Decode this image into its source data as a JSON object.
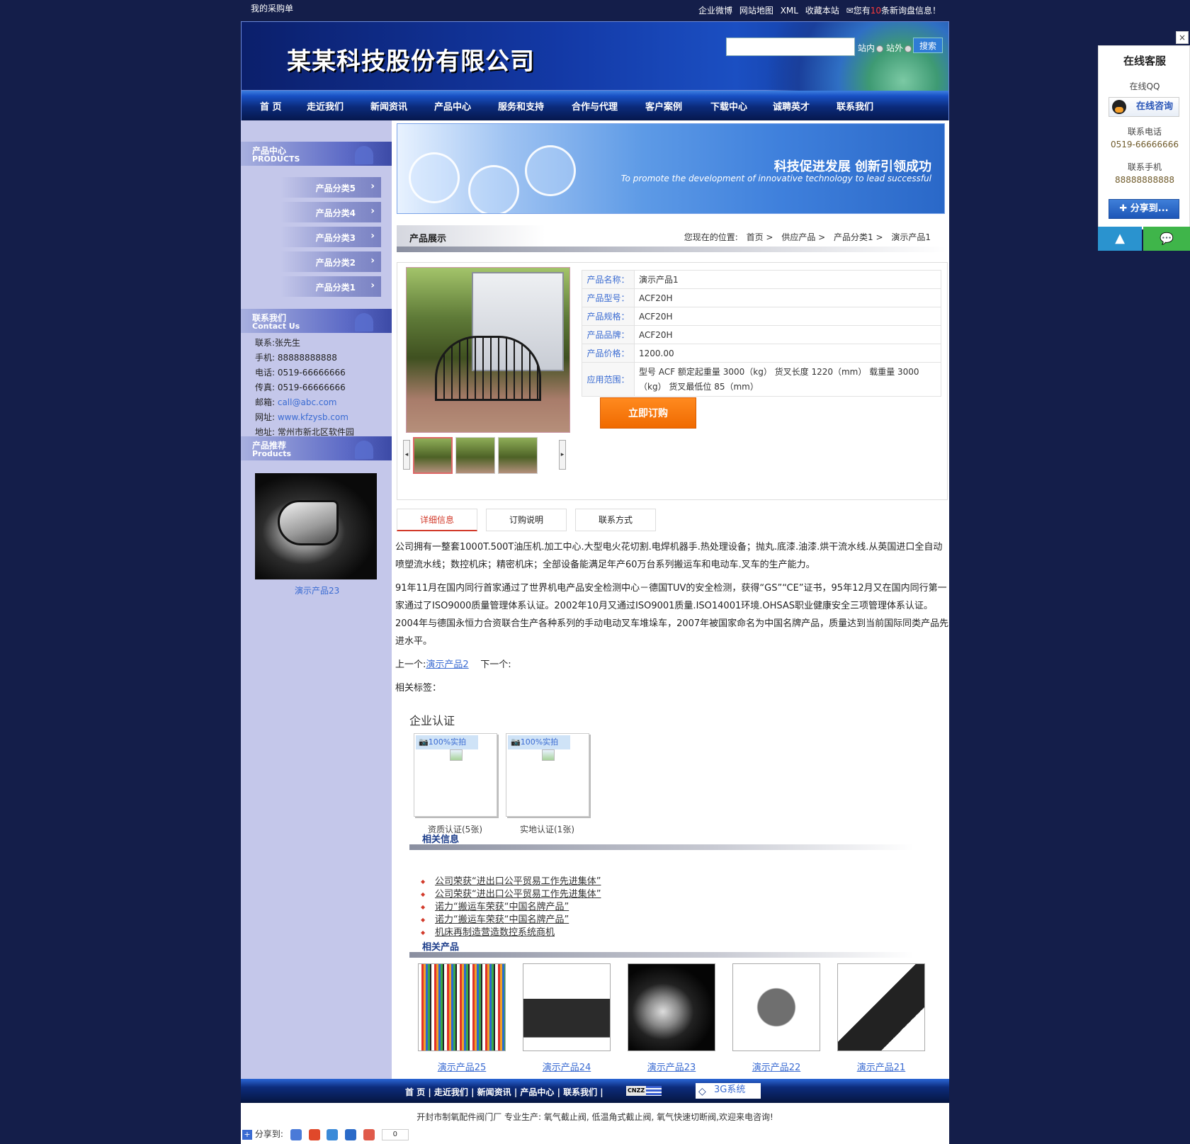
{
  "topbar": {
    "cart": "我的采购单",
    "links": [
      "企业微博",
      "网站地图",
      "XML",
      "收藏本站"
    ],
    "msg_prefix": "您有",
    "msg_count": "10",
    "msg_suffix": "条新询盘信息！"
  },
  "header": {
    "company": "某某科技股份有限公司",
    "search_placeholder": "",
    "scope_site": "站内",
    "scope_web": "站外",
    "search_label": "搜索"
  },
  "nav": [
    "首 页",
    "走近我们",
    "新闻资讯",
    "产品中心",
    "服务和支持",
    "合作与代理",
    "客户案例",
    "下载中心",
    "诚聘英才",
    "联系我们"
  ],
  "sidebar": {
    "products_title": "产品中心",
    "products_en": "PRODUCTS",
    "categories": [
      "产品分类5",
      "产品分类4",
      "产品分类3",
      "产品分类2",
      "产品分类1"
    ],
    "contact_title": "联系我们",
    "contact_en": "Contact Us",
    "contact_lines": [
      "联系:张先生",
      "手机: 88888888888",
      "电话: 0519-66666666",
      "传真: 0519-66666666"
    ],
    "email_label": "邮箱: ",
    "email": "call@abc.com",
    "website_label": "网址: ",
    "website": "www.kfzysb.com",
    "address": "地址: 常州市新北区软件园",
    "recommend_title": "产品推荐",
    "recommend_en": "Products",
    "recommend_item": "演示产品23"
  },
  "banner": {
    "title": "科技促进发展  创新引领成功",
    "subtitle": "To promote the development of innovative technology to lead successful"
  },
  "crumb": {
    "section": "产品展示",
    "prefix": "您现在的位置:",
    "items": [
      "首页 >",
      "供应产品 >",
      "产品分类1 >",
      "演示产品1"
    ]
  },
  "product": {
    "specs": [
      {
        "k": "产品名称：",
        "v": "演示产品1"
      },
      {
        "k": "产品型号：",
        "v": "ACF20H"
      },
      {
        "k": "产品规格：",
        "v": "ACF20H"
      },
      {
        "k": "产品品牌：",
        "v": "ACF20H"
      },
      {
        "k": "产品价格：",
        "v": "1200.00"
      },
      {
        "k": "应用范围：",
        "v": "型号 ACF 额定起重量 3000（kg） 货叉长度 1220（mm） 载重量 3000（kg） 货叉最低位 85（mm）"
      }
    ],
    "buy_label": "立即订购"
  },
  "tabs": [
    "详细信息",
    "订购说明",
    "联系方式"
  ],
  "description": {
    "p1": "公司拥有一整套1000T.500T油压机.加工中心.大型电火花切割.电焊机器手.热处理设备；抛丸.底漆.油漆.烘干流水线.从英国进口全自动喷塑流水线；数控机床；精密机床；全部设备能满足年产60万台系列搬运车和电动车.叉车的生产能力。",
    "p2": "91年11月在国内同行首家通过了世界机电产品安全检测中心－德国TUV的安全检测，获得“GS”“CE”证书，95年12月又在国内同行第一家通过了ISO9000质量管理体系认证。2002年10月又通过ISO9001质量.ISO14001环境.OHSAS职业健康安全三项管理体系认证。2004年与德国永恒力合资联合生产各种系列的手动电动叉车堆垛车，2007年被国家命名为中国名牌产品，质量达到当前国际同类产品先进水平。",
    "prev_label": "上一个:",
    "prev_link": "演示产品2",
    "next_label": "下一个:",
    "tags_label": "相关标签："
  },
  "certs": {
    "title": "企业认证",
    "badge": "100%实拍",
    "items": [
      "资质认证(5张)",
      "实地认证(1张)"
    ]
  },
  "related_info": {
    "title": "相关信息",
    "items": [
      "公司荣获“进出口公平贸易工作先进集体”",
      "公司荣获“进出口公平贸易工作先进集体”",
      "诺力“搬运车荣获“中国名牌产品”",
      "诺力“搬运车荣获“中国名牌产品”",
      "机床再制造营造数控系统商机"
    ]
  },
  "related_products": {
    "title": "相关产品",
    "items": [
      "演示产品25",
      "演示产品24",
      "演示产品23",
      "演示产品22",
      "演示产品21"
    ]
  },
  "footer": {
    "links": "首 页 |  走近我们 |  新闻资讯 |  产品中心 |  联系我们 |",
    "cnzz": "CNZZ",
    "system": "3G系统",
    "copyright": "开封市制氧配件阀门厂 专业生产: 氧气截止阀, 低温角式截止阀, 氧气快速切断阀,欢迎来电咨询!",
    "share_label": "分享到:",
    "share_count": "0"
  },
  "service": {
    "title": "在线客服",
    "qq_label": "在线QQ",
    "qq_button": "在线咨询",
    "phone_label": "联系电话",
    "phone": "0519-66666666",
    "mobile_label": "联系手机",
    "mobile": "88888888888",
    "share_button": "分享到...",
    "close": "×"
  }
}
